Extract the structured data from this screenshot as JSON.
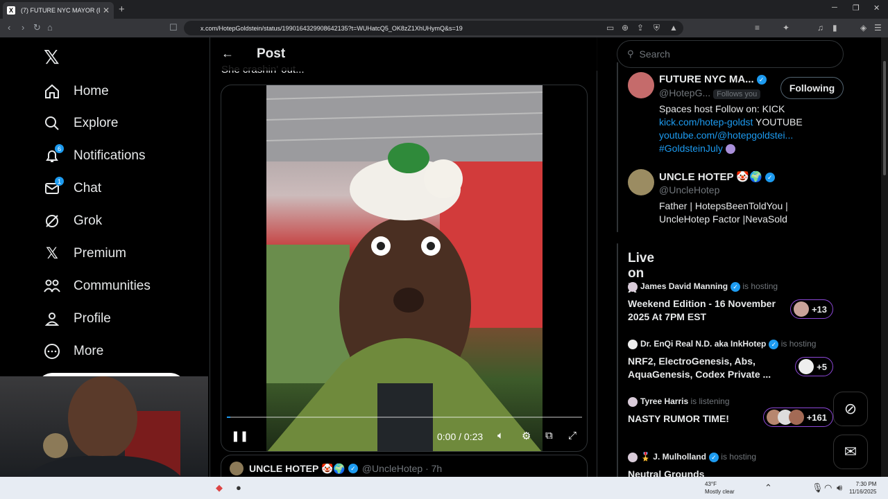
{
  "browser": {
    "tab_title": "(7) FUTURE NYC MAYOR (Bec",
    "tab_close": "✕",
    "new_tab": "+",
    "url": "x.com/HotepGoldstein/status/1990164329908642135?t=WUHatcQ5_OK8zZ1XhUHymQ&s=19"
  },
  "sidebar": {
    "items": [
      {
        "label": "Home",
        "icon": "home-icon"
      },
      {
        "label": "Explore",
        "icon": "search-icon"
      },
      {
        "label": "Notifications",
        "icon": "bell-icon",
        "badge": "6"
      },
      {
        "label": "Chat",
        "icon": "mail-icon",
        "badge": "1"
      },
      {
        "label": "Grok",
        "icon": "grok-icon"
      },
      {
        "label": "Premium",
        "icon": "x-icon"
      },
      {
        "label": "Communities",
        "icon": "people-icon"
      },
      {
        "label": "Profile",
        "icon": "person-icon"
      },
      {
        "label": "More",
        "icon": "more-icon"
      }
    ]
  },
  "main": {
    "header_title": "Post",
    "tweet_text_partial": "She crashin' out...",
    "video": {
      "time": "0:00 / 0:23",
      "progress_fraction": 0.01
    },
    "reply": {
      "name": "UNCLE HOTEP 🤡🌍",
      "handle": "@UncleHotep · 7h"
    }
  },
  "right": {
    "search_placeholder": "Search",
    "profile1": {
      "name": "FUTURE NYC MA...",
      "handle": "@HotepG...",
      "follows_you": "Follows you",
      "following_btn": "Following",
      "bio_line1": "Spaces host Follow on: KICK",
      "bio_link1": "kick.com/hotep-goldst",
      "bio_after_link1": " YOUTUBE",
      "bio_link2": "youtube.com/@hotepgoldstei...",
      "bio_link3": "#GoldsteinJuly"
    },
    "profile2": {
      "name": "UNCLE HOTEP 🤡🌍",
      "handle": "@UncleHotep",
      "bio": "Father | HotepsBeenToldYou | UncleHotep Factor |NevaSold"
    },
    "live": {
      "title": "Live on X",
      "items": [
        {
          "host": "James David Manning",
          "status": "is hosting",
          "topic": "Weekend Edition - 16 November 2025 At 7PM EST",
          "count": "+13"
        },
        {
          "host": "Dr. EnQi Real N.D. aka InkHotep",
          "status": "is hosting",
          "topic": "NRF2, ElectroGenesis, Abs, AquaGenesis, Codex Private ...",
          "count": "+5"
        },
        {
          "host": "Tyree Harris",
          "status": "is listening",
          "topic": "NASTY RUMOR TIME!",
          "count": "+161"
        },
        {
          "host": "🎖️ J. Mulholland",
          "status": "is hosting",
          "topic": "Neutral Grounds",
          "count": ""
        }
      ]
    }
  },
  "taskbar": {
    "weather_temp": "43°F",
    "weather_desc": "Mostly clear",
    "time": "7:30 PM",
    "date": "11/16/2025"
  }
}
